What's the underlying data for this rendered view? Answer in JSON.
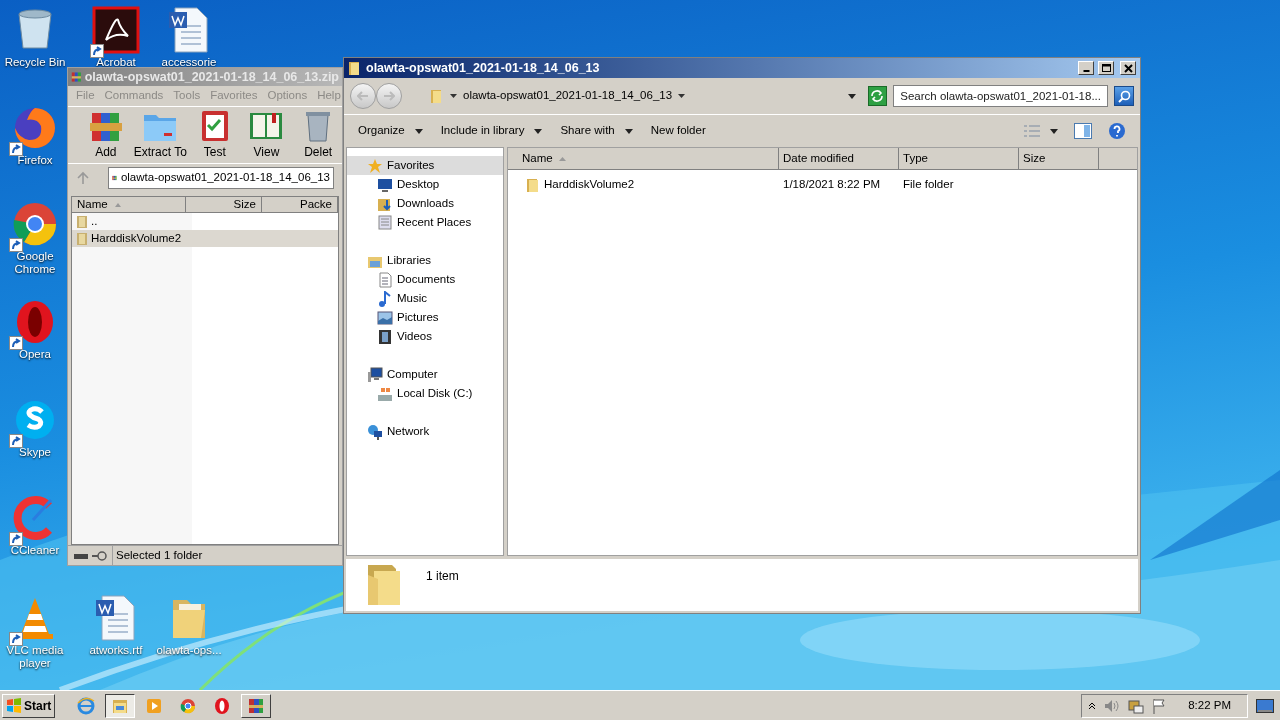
{
  "desktop_icons": [
    {
      "label": "Recycle Bin",
      "kind": "bin",
      "shortcut": false
    },
    {
      "label": "Acrobat",
      "kind": "pdf",
      "shortcut": true
    },
    {
      "label": "accessorie",
      "kind": "doc",
      "shortcut": false
    },
    {
      "label": "Firefox",
      "kind": "firefox",
      "shortcut": true
    },
    {
      "label": "Google Chrome",
      "kind": "chrome",
      "shortcut": true
    },
    {
      "label": "Opera",
      "kind": "opera",
      "shortcut": true
    },
    {
      "label": "Skype",
      "kind": "skype",
      "shortcut": true
    },
    {
      "label": "CCleaner",
      "kind": "ccleaner",
      "shortcut": true
    },
    {
      "label": "VLC media player",
      "kind": "vlc",
      "shortcut": true
    },
    {
      "label": "atworks.rtf",
      "kind": "doc",
      "shortcut": false
    },
    {
      "label": "olawta-ops...",
      "kind": "folder",
      "shortcut": false
    }
  ],
  "archiver": {
    "title": "olawta-opswat01_2021-01-18_14_06_13.zip",
    "menu": [
      "File",
      "Commands",
      "Tools",
      "Favorites",
      "Options",
      "Help"
    ],
    "toolbar": [
      {
        "label": "Add",
        "kind": "add"
      },
      {
        "label": "Extract To",
        "kind": "extract"
      },
      {
        "label": "Test",
        "kind": "test"
      },
      {
        "label": "View",
        "kind": "view"
      },
      {
        "label": "Delet",
        "kind": "delete"
      }
    ],
    "path": "olawta-opswat01_2021-01-18_14_06_13",
    "columns": [
      "Name",
      "Size",
      "Packe"
    ],
    "rows": [
      {
        "name": "..",
        "selected": false
      },
      {
        "name": "HarddiskVolume2",
        "selected": true
      }
    ],
    "status": "Selected 1 folder"
  },
  "explorer": {
    "title": "olawta-opswat01_2021-01-18_14_06_13",
    "address": "olawta-opswat01_2021-01-18_14_06_13",
    "search": {
      "placeholder": "Search olawta-opswat01_2021-01-18..."
    },
    "commands": [
      {
        "label": "Organize",
        "dropdown": true
      },
      {
        "label": "Include in library",
        "dropdown": true
      },
      {
        "label": "Share with",
        "dropdown": true
      },
      {
        "label": "New folder",
        "dropdown": false
      }
    ],
    "nav": [
      {
        "label": "Favorites",
        "kind": "star",
        "selected": true,
        "children": [
          {
            "label": "Desktop",
            "kind": "desktop",
            "selected": false
          },
          {
            "label": "Downloads",
            "kind": "downloads",
            "selected": false
          },
          {
            "label": "Recent Places",
            "kind": "recent",
            "selected": false
          }
        ]
      },
      {
        "label": "Libraries",
        "kind": "libraries",
        "selected": false,
        "children": [
          {
            "label": "Documents",
            "kind": "documents",
            "selected": false
          },
          {
            "label": "Music",
            "kind": "music",
            "selected": false
          },
          {
            "label": "Pictures",
            "kind": "pictures",
            "selected": false
          },
          {
            "label": "Videos",
            "kind": "videos",
            "selected": false
          }
        ]
      },
      {
        "label": "Computer",
        "kind": "computer",
        "selected": false,
        "children": [
          {
            "label": "Local Disk (C:)",
            "kind": "disk",
            "selected": false
          }
        ]
      },
      {
        "label": "Network",
        "kind": "network",
        "selected": false
      }
    ],
    "columns": [
      "Name",
      "Date modified",
      "Type",
      "Size"
    ],
    "rows": [
      {
        "name": "HarddiskVolume2",
        "date": "1/18/2021 8:22 PM",
        "type": "File folder"
      }
    ],
    "details": "1 item"
  },
  "taskbar": {
    "start": "Start",
    "items": [
      {
        "kind": "ie",
        "selected": false
      },
      {
        "kind": "explorer",
        "selected": true
      },
      {
        "kind": "media",
        "selected": false
      },
      {
        "kind": "chrome",
        "selected": false
      },
      {
        "kind": "opera",
        "selected": false
      },
      {
        "kind": "winrar",
        "selected": false
      }
    ],
    "clock": "8:22 PM"
  }
}
